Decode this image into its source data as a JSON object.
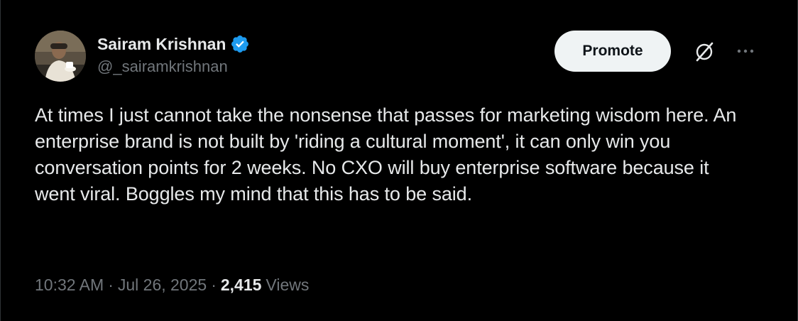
{
  "author": {
    "display_name": "Sairam Krishnan",
    "handle": "@_sairamkrishnan",
    "verified": true,
    "avatar_icon": "user-avatar-photo"
  },
  "actions": {
    "promote_label": "Promote",
    "grok_icon": "grok-icon",
    "more_icon": "more-options-icon"
  },
  "tweet": {
    "text": "At times I just cannot take the nonsense that passes for marketing wisdom here. An enterprise brand is not built by 'riding a cultural moment', it can only win you conversation points for 2 weeks. No CXO will buy enterprise software because it went viral. Boggles my mind that this has to be said."
  },
  "meta": {
    "time": "10:32 AM",
    "separator": "·",
    "date": "Jul 26, 2025",
    "views_count": "2,415",
    "views_label": "Views"
  },
  "colors": {
    "background": "#000000",
    "primary_text": "#e7e9ea",
    "secondary_text": "#71767b",
    "verified_blue": "#1d9bf0",
    "button_bg": "#eff3f4",
    "border": "#2f3336"
  }
}
